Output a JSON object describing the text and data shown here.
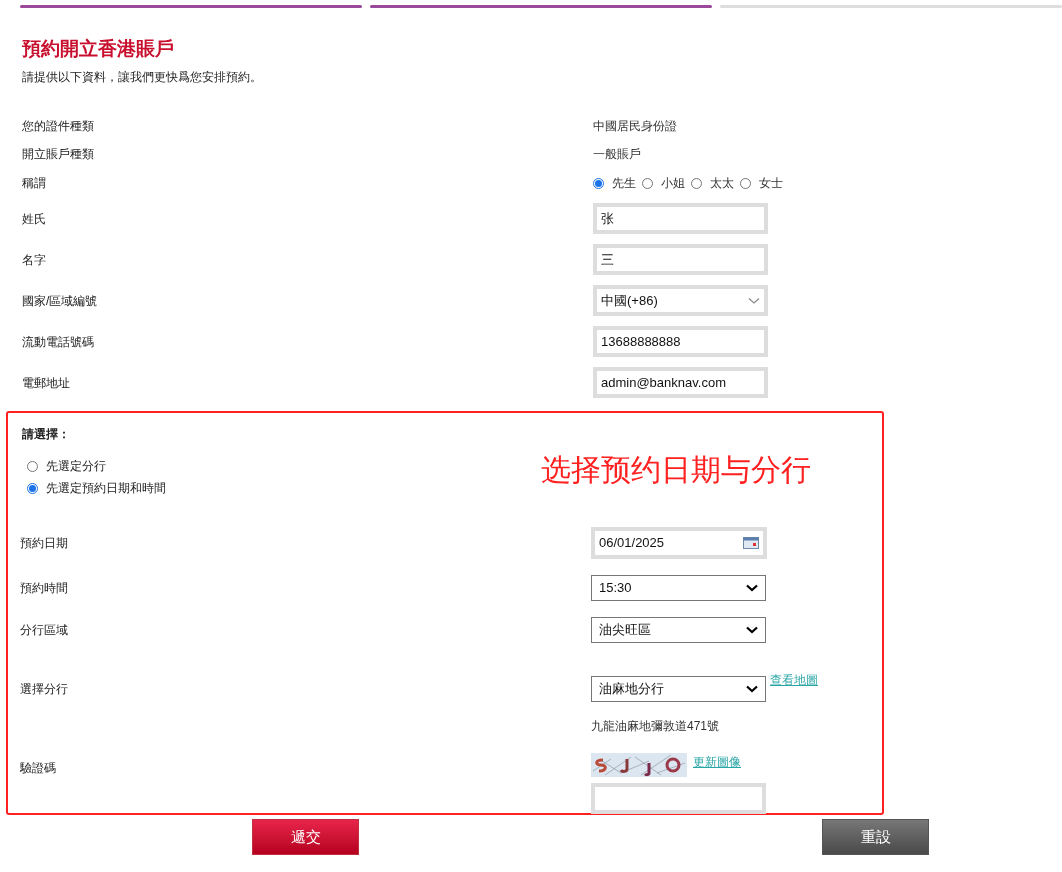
{
  "progress_steps": [
    {
      "done": true
    },
    {
      "done": true
    },
    {
      "done": false
    }
  ],
  "title": "預約開立香港賬戶",
  "intro": "請提供以下資料，讓我們更快爲您安排預約。",
  "fields": [
    {
      "kind": "static",
      "label": "您的證件種類",
      "value": "中國居民身份證"
    },
    {
      "kind": "static",
      "label": "開立賬戶種類",
      "value": "一般賬戶"
    },
    {
      "kind": "radio",
      "label": "稱謂",
      "options": [
        {
          "label": "先生",
          "selected": true
        },
        {
          "label": "小姐",
          "selected": false
        },
        {
          "label": "太太",
          "selected": false
        },
        {
          "label": "女士",
          "selected": false
        }
      ]
    },
    {
      "kind": "input",
      "label": "姓氏",
      "value": "张"
    },
    {
      "kind": "input",
      "label": "名字",
      "value": "三"
    },
    {
      "kind": "dropdown",
      "label": "國家/區域編號",
      "value": "中國(+86)"
    },
    {
      "kind": "input",
      "label": "流動電話號碼",
      "value": "13688888888"
    },
    {
      "kind": "input",
      "label": "電郵地址",
      "value": "admin@banknav.com"
    }
  ],
  "appointment": {
    "annotation": "选择预约日期与分行",
    "prompt": "請選擇：",
    "modes": [
      {
        "label": "先選定分行",
        "selected": false
      },
      {
        "label": "先選定預約日期和時間",
        "selected": true
      }
    ],
    "fields": [
      {
        "kind": "date",
        "label": "預約日期",
        "value": "06/01/2025"
      },
      {
        "kind": "select",
        "label": "預約時間",
        "value": "15:30"
      },
      {
        "kind": "select",
        "label": "分行區域",
        "value": "油尖旺區"
      },
      {
        "kind": "select",
        "label": "選擇分行",
        "value": "油麻地分行",
        "link": "查看地圖",
        "note": "九龍油麻地彌敦道471號"
      },
      {
        "kind": "captcha",
        "label": "驗證碼",
        "link": "更新圖像"
      }
    ]
  },
  "buttons": [
    {
      "kind": "submit",
      "label": "遞交"
    },
    {
      "kind": "reset",
      "label": "重設"
    }
  ]
}
